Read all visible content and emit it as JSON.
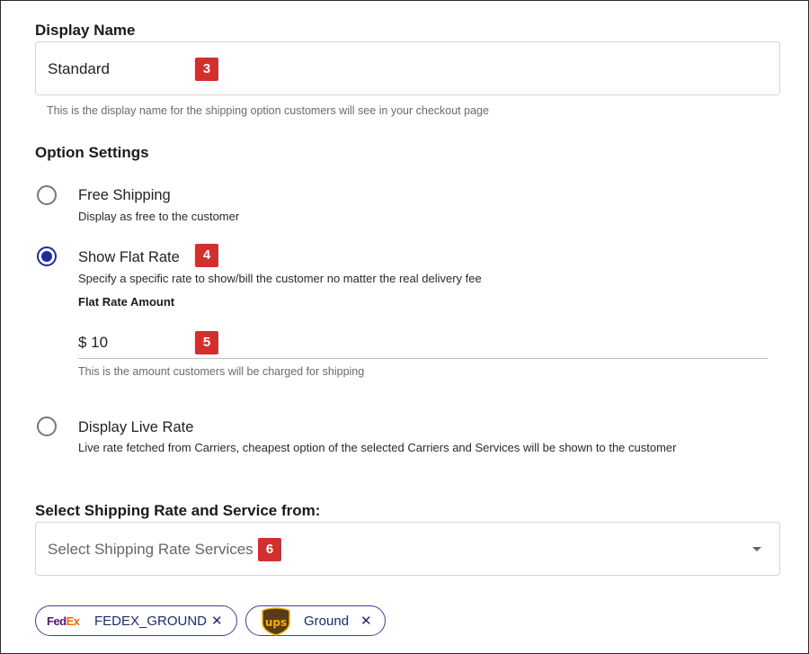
{
  "display_name": {
    "title": "Display Name",
    "value": "Standard",
    "badge": "3",
    "helper": "This is the display name for the shipping option customers will see in your checkout page"
  },
  "option_settings": {
    "title": "Option Settings",
    "options": [
      {
        "label": "Free Shipping",
        "description": "Display as free to the customer",
        "selected": false
      },
      {
        "label": "Show Flat Rate",
        "description": "Specify a specific rate to show/bill the customer no matter the real delivery fee",
        "selected": true,
        "badge": "4"
      },
      {
        "label": "Display Live Rate",
        "description": "Live rate fetched from Carriers, cheapest option of the selected Carriers and Services will be shown to the customer",
        "selected": false
      }
    ],
    "flat_rate": {
      "label": "Flat Rate Amount",
      "value": "$ 10",
      "badge": "5",
      "helper": "This is the amount customers will be charged for shipping"
    }
  },
  "shipping_services": {
    "title": "Select Shipping Rate and Service from:",
    "placeholder": "Select Shipping Rate Services",
    "badge": "6",
    "chips": [
      {
        "carrier_logo": "fedex-logo",
        "logo_text_1": "Fed",
        "logo_text_2": "Ex",
        "label": "FEDEX_GROUND",
        "remove": "✕"
      },
      {
        "carrier_logo": "ups-logo",
        "logo_text": "ups",
        "label": "Ground",
        "remove": "✕"
      }
    ]
  },
  "colors": {
    "accent": "#1f2a9a",
    "badge": "#d32f2f",
    "chip_border": "#3d3f9b",
    "fedex_purple": "#4d148c",
    "fedex_orange": "#ff6200",
    "ups_brown": "#5a3a1a",
    "ups_gold": "#f5b400"
  }
}
